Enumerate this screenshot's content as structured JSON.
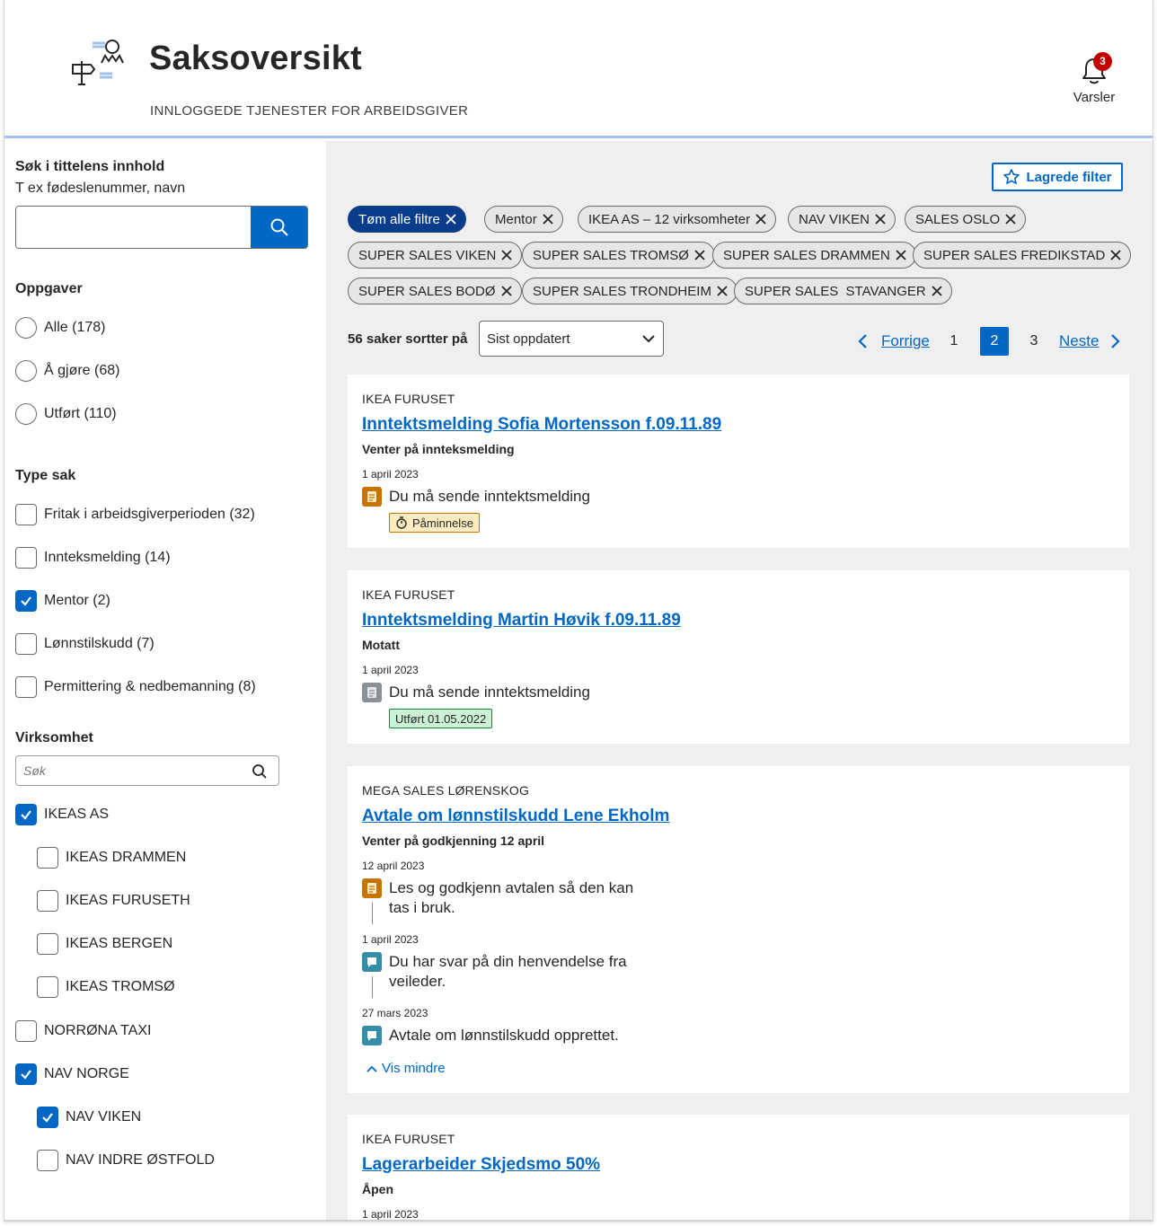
{
  "header": {
    "title": "Saksoversikt",
    "subtitle": "INNLOGGEDE TJENESTER FOR ARBEIDSGIVER",
    "notifications_label": "Varsler",
    "notifications_count": "3"
  },
  "sidebar": {
    "search_label": "Søk i tittelens innhold",
    "search_hint": "T ex fødeslenummer, navn",
    "search_value": "",
    "oppgaver_label": "Oppgaver",
    "oppgaver": [
      {
        "label": "Alle (178)",
        "selected": false
      },
      {
        "label": "Å gjøre (68)",
        "selected": false
      },
      {
        "label": "Utført (110)",
        "selected": false
      }
    ],
    "type_label": "Type sak",
    "types": [
      {
        "label": "Fritak i arbeidsgiverperioden (32)",
        "checked": false
      },
      {
        "label": "Innteksmelding (14)",
        "checked": false
      },
      {
        "label": "Mentor (2)",
        "checked": true
      },
      {
        "label": "Lønnstilskudd (7)",
        "checked": false
      },
      {
        "label": "Permittering & nedbemanning (8)",
        "checked": false
      }
    ],
    "virksomhet_label": "Virksomhet",
    "virksomhet_search_placeholder": "Søk",
    "virksomheter": [
      {
        "label": "IKEAS AS",
        "checked": true
      },
      {
        "label": "IKEAS DRAMMEN",
        "checked": false
      },
      {
        "label": "IKEAS FURUSETH",
        "checked": false
      },
      {
        "label": "IKEAS BERGEN",
        "checked": false
      },
      {
        "label": "IKEAS TROMSØ",
        "checked": false
      },
      {
        "label": "NORRØNA TAXI",
        "checked": false
      },
      {
        "label": "NAV NORGE",
        "checked": true
      },
      {
        "label": "NAV VIKEN",
        "checked": true
      },
      {
        "label": "NAV INDRE ØSTFOLD",
        "checked": false
      }
    ]
  },
  "main": {
    "saved_filter_label": "Lagrede filter",
    "clear_filters_label": "Tøm alle filtre",
    "chips": [
      "Mentor",
      "IKEA AS – 12 virksomheter",
      "NAV VIKEN",
      "SALES OSLO",
      "SUPER SALES VIKEN",
      "SUPER SALES TROMSØ",
      "SUPER SALES DRAMMEN",
      "SUPER SALES FREDIKSTAD",
      "SUPER SALES BODØ",
      "SUPER SALES TRONDHEIM",
      "SUPER SALES  STAVANGER"
    ],
    "count_label": "56 saker sortter på",
    "sort_value": "Sist oppdatert",
    "pager": {
      "prev": "Forrige",
      "next": "Neste",
      "pages": [
        "1",
        "2",
        "3"
      ],
      "current": "2"
    },
    "cards": [
      {
        "org": "IKEA FURUSET",
        "title": "Inntektsmelding Sofia Mortensson f.09.11.89",
        "status": "Venter på innteksmelding",
        "events": [
          {
            "date": "1 april 2023",
            "text": "Du må sende inntektsmelding",
            "icon": "task-icon",
            "tag": "Påminnelse"
          }
        ]
      },
      {
        "org": "IKEA FURUSET",
        "title": "Inntektsmelding Martin Høvik f.09.11.89",
        "status": "Motatt",
        "events": [
          {
            "date": "1 april 2023",
            "text": "Du må sende inntektsmelding",
            "icon": "task-icon",
            "tag": "Utført 01.05.2022"
          }
        ]
      },
      {
        "org": "MEGA SALES LØRENSKOG",
        "title": "Avtale om lønnstilskudd Lene Ekholm",
        "status": "Venter på godkjenning 12 april",
        "events": [
          {
            "date": "12 april 2023",
            "text1": "Les og godkjenn avtalen så den kan",
            "text2": "tas i bruk.",
            "icon": "task-icon"
          },
          {
            "date": "1 april 2023",
            "text1": "Du har svar på din henvendelse fra",
            "text2": "veileder.",
            "icon": "message-icon"
          },
          {
            "date": "27 mars 2023",
            "text": "Avtale om lønnstilskudd opprettet.",
            "icon": "message-icon"
          }
        ],
        "toggle": "Vis mindre"
      },
      {
        "org": "IKEA FURUSET",
        "title": "Lagerarbeider Skjedsmo 50%",
        "status": "Åpen",
        "events": [
          {
            "date": "1 april 2023"
          }
        ]
      }
    ]
  },
  "colors": {
    "accent": "#0067c5",
    "chip_primary": "#0a3c8c",
    "warning_bg": "#ffecc0",
    "success_bg": "#ccf1d6",
    "badge": "#c30000",
    "task_orange": "#c77300",
    "task_grey": "#8a8f98",
    "message_blue": "#368da8"
  }
}
